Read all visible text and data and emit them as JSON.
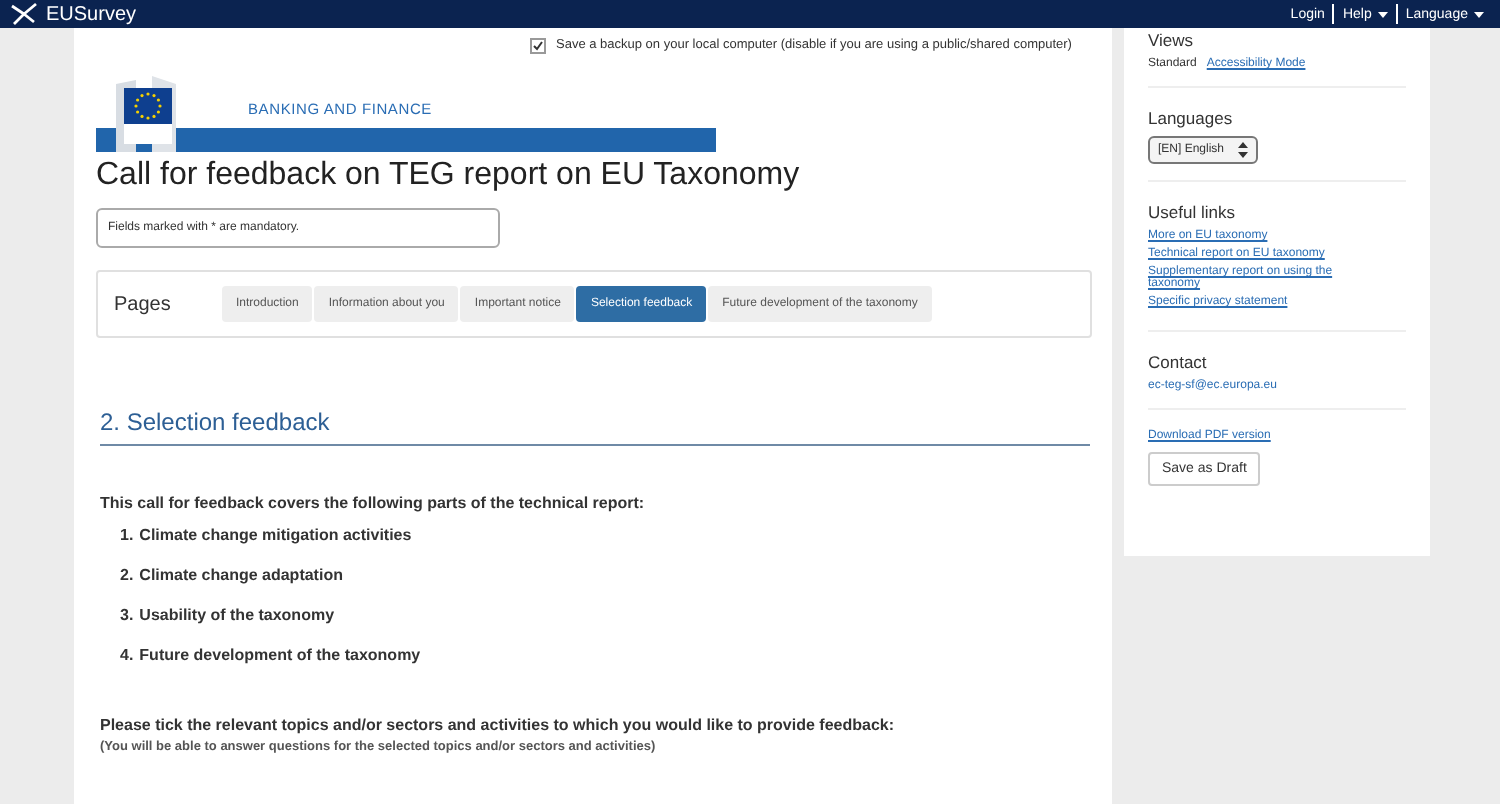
{
  "topbar": {
    "brand": "EUSurvey",
    "menu": [
      {
        "label": "Login",
        "dropdown": false
      },
      {
        "label": "Help",
        "dropdown": true
      },
      {
        "label": "Language",
        "dropdown": true
      }
    ]
  },
  "backup": {
    "label": "Save a backup on your local computer (disable if you are using a public/shared computer)",
    "checked": true
  },
  "banner": {
    "department": "BANKING AND FINANCE"
  },
  "title": "Call for feedback on TEG report on EU Taxonomy",
  "mandatory_note": "Fields marked with * are mandatory.",
  "pages": {
    "label": "Pages",
    "tabs": [
      {
        "label": "Introduction",
        "selected": false
      },
      {
        "label": "Information about you",
        "selected": false
      },
      {
        "label": "Important notice",
        "selected": false
      },
      {
        "label": "Selection feedback",
        "selected": true
      },
      {
        "label": "Future development of the taxonomy",
        "selected": false
      }
    ]
  },
  "section": {
    "heading": "2. Selection feedback",
    "intro": "This call for feedback covers the following parts of the technical report:",
    "items": [
      {
        "number": "1.",
        "text": "Climate change mitigation activities"
      },
      {
        "number": "2.",
        "text": "Climate change adaptation"
      },
      {
        "number": "3.",
        "text": "Usability of the taxonomy"
      },
      {
        "number": "4.",
        "text": "Future development of the taxonomy"
      }
    ],
    "question": "Please tick the relevant topics and/or sectors and activities to which you would like to provide feedback:",
    "hint": "(You will be able to answer questions for the selected topics and/or sectors and activities)"
  },
  "sidebar": {
    "views": {
      "heading": "Views",
      "options": [
        {
          "label": "Standard",
          "selected": true
        },
        {
          "label": "Accessibility Mode",
          "selected": false
        }
      ]
    },
    "languages": {
      "heading": "Languages",
      "value": "[EN] English"
    },
    "useful_links": {
      "heading": "Useful links",
      "links": [
        "More on EU taxonomy",
        "Technical report on EU taxonomy",
        "Supplementary report on using the taxonomy",
        "Specific privacy statement"
      ]
    },
    "contact": {
      "heading": "Contact",
      "email": "ec-teg-sf@ec.europa.eu"
    },
    "download": "Download PDF version",
    "save_button": "Save as Draft"
  }
}
